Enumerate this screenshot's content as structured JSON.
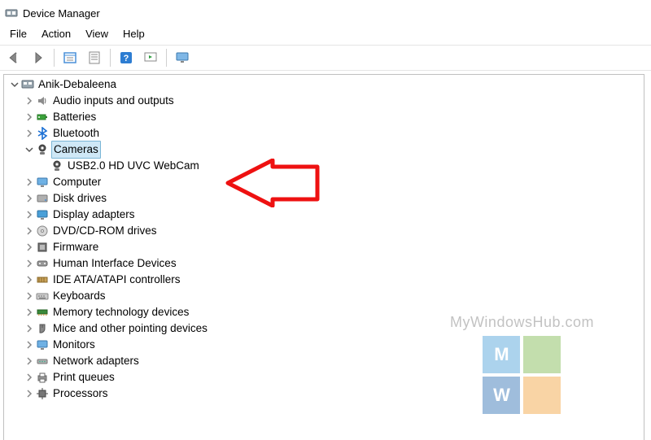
{
  "window": {
    "title": "Device Manager"
  },
  "menu": {
    "items": [
      "File",
      "Action",
      "View",
      "Help"
    ]
  },
  "toolbar": {
    "back": "back-icon",
    "forward": "forward-icon",
    "show_hidden": "show-hidden-icon",
    "properties": "properties-icon",
    "help": "help-icon",
    "scan": "scan-icon",
    "monitor": "monitor-icon"
  },
  "tree": {
    "root": {
      "label": "Anik-Debaleena",
      "icon": "computer-root-icon",
      "expanded": true,
      "children": [
        {
          "label": "Audio inputs and outputs",
          "icon": "audio-icon",
          "expandable": true
        },
        {
          "label": "Batteries",
          "icon": "battery-icon",
          "expandable": true
        },
        {
          "label": "Bluetooth",
          "icon": "bluetooth-icon",
          "expandable": true
        },
        {
          "label": "Cameras",
          "icon": "camera-icon",
          "expandable": true,
          "expanded": true,
          "selected": true,
          "children": [
            {
              "label": "USB2.0 HD UVC WebCam",
              "icon": "camera-icon"
            }
          ]
        },
        {
          "label": "Computer",
          "icon": "computer-icon",
          "expandable": true
        },
        {
          "label": "Disk drives",
          "icon": "disk-icon",
          "expandable": true
        },
        {
          "label": "Display adapters",
          "icon": "display-icon",
          "expandable": true
        },
        {
          "label": "DVD/CD-ROM drives",
          "icon": "dvd-icon",
          "expandable": true
        },
        {
          "label": "Firmware",
          "icon": "firmware-icon",
          "expandable": true
        },
        {
          "label": "Human Interface Devices",
          "icon": "hid-icon",
          "expandable": true
        },
        {
          "label": "IDE ATA/ATAPI controllers",
          "icon": "ide-icon",
          "expandable": true
        },
        {
          "label": "Keyboards",
          "icon": "keyboard-icon",
          "expandable": true
        },
        {
          "label": "Memory technology devices",
          "icon": "memory-icon",
          "expandable": true
        },
        {
          "label": "Mice and other pointing devices",
          "icon": "mouse-icon",
          "expandable": true
        },
        {
          "label": "Monitors",
          "icon": "monitor-icon",
          "expandable": true
        },
        {
          "label": "Network adapters",
          "icon": "network-icon",
          "expandable": true
        },
        {
          "label": "Print queues",
          "icon": "printer-icon",
          "expandable": true
        },
        {
          "label": "Processors",
          "icon": "cpu-icon",
          "expandable": true
        }
      ]
    }
  },
  "watermark": {
    "text": "MyWindowsHub.com",
    "letters": [
      "M",
      "",
      "W",
      ""
    ]
  }
}
